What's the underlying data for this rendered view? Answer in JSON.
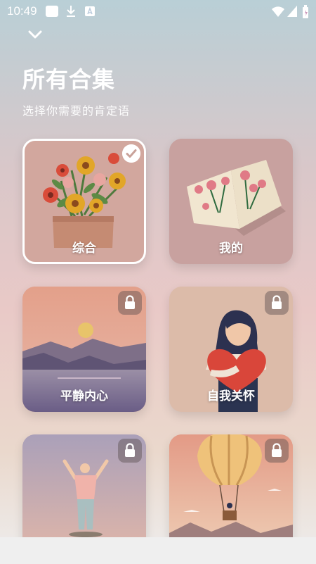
{
  "status_bar": {
    "time": "10:49",
    "left_icons": [
      "app-icon",
      "download-icon",
      "font-icon"
    ],
    "right_icons": [
      "wifi-icon",
      "signal-icon",
      "battery-icon"
    ]
  },
  "header": {
    "collapse_icon": "chevron-down-icon",
    "title": "所有合集",
    "subtitle": "选择你需要的肯定语"
  },
  "collections": [
    {
      "label": "综合",
      "art": "flowers-in-box",
      "selected": true,
      "locked": false,
      "bg": "#d2a79e"
    },
    {
      "label": "我的",
      "art": "open-book-flowers",
      "selected": false,
      "locked": false,
      "bg": "#c8a19f"
    },
    {
      "label": "平静内心",
      "art": "lake-sunset",
      "selected": false,
      "locked": true,
      "bg": "#d9a28f"
    },
    {
      "label": "自我关怀",
      "art": "woman-hugging-heart",
      "selected": false,
      "locked": true,
      "bg": "#dcbba9"
    },
    {
      "label": "",
      "art": "man-arms-raised",
      "selected": false,
      "locked": true,
      "bg": "#b9a8b8"
    },
    {
      "label": "",
      "art": "hot-air-balloon",
      "selected": false,
      "locked": true,
      "bg": "#e0a88f"
    }
  ],
  "colors": {
    "text": "#ffffff",
    "lock_bg": "#5a5050",
    "check": "#ffffff"
  }
}
